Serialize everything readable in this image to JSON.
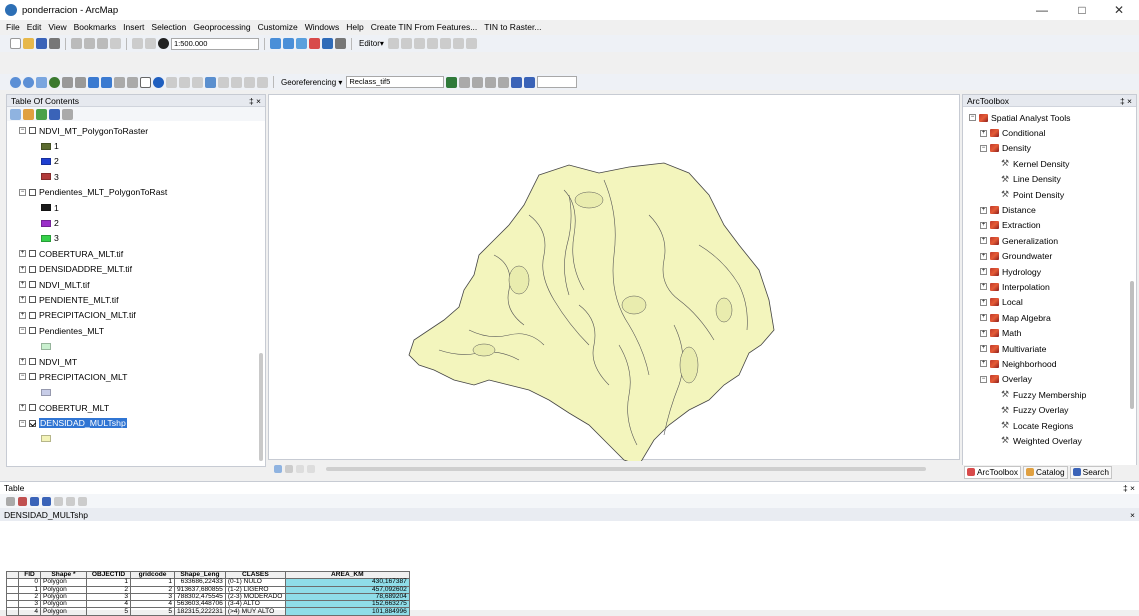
{
  "window": {
    "title": "ponderracion - ArcMap",
    "controls": [
      "—",
      "□",
      "✕"
    ]
  },
  "menu": [
    "File",
    "Edit",
    "View",
    "Bookmarks",
    "Insert",
    "Selection",
    "Geoprocessing",
    "Customize",
    "Windows",
    "Help",
    "Create TIN From Features...",
    "TIN to Raster..."
  ],
  "toolbar": {
    "scale": "1:500.000",
    "editor": "Editor▾",
    "georeferencing": "Georeferencing ▾",
    "reclass_layer": "Reclass_tif5"
  },
  "toc": {
    "title": "Table Of Contents",
    "pin": "‡ ×",
    "rows": [
      {
        "type": "layer",
        "expand": "−",
        "checked": false,
        "label": "NDVI_MT_PolygonToRaster"
      },
      {
        "type": "legend",
        "color": "#5b6b2f",
        "label": "1"
      },
      {
        "type": "legend",
        "color": "#1f3fd1",
        "label": "2"
      },
      {
        "type": "legend",
        "color": "#b23b3b",
        "label": "3"
      },
      {
        "type": "layer",
        "expand": "−",
        "checked": false,
        "label": "Pendientes_MLT_PolygonToRast"
      },
      {
        "type": "legend",
        "color": "#1a1a1a",
        "label": "1"
      },
      {
        "type": "legend",
        "color": "#9b2fc9",
        "label": "2"
      },
      {
        "type": "legend",
        "color": "#35d04a",
        "label": "3"
      },
      {
        "type": "layer",
        "expand": "+",
        "checked": false,
        "label": "COBERTURA_MLT.tif"
      },
      {
        "type": "layer",
        "expand": "+",
        "checked": false,
        "label": "DENSIDADDRE_MLT.tif"
      },
      {
        "type": "layer",
        "expand": "+",
        "checked": false,
        "label": "NDVI_MLT.tif"
      },
      {
        "type": "layer",
        "expand": "+",
        "checked": false,
        "label": "PENDIENTE_MLT.tif"
      },
      {
        "type": "layer",
        "expand": "+",
        "checked": false,
        "label": "PRECIPITACION_MLT.tif"
      },
      {
        "type": "layer",
        "expand": "−",
        "checked": false,
        "label": "Pendientes_MLT"
      },
      {
        "type": "legend",
        "color": "#c9f0cf",
        "label": ""
      },
      {
        "type": "layer",
        "expand": "+",
        "checked": false,
        "label": "NDVI_MT"
      },
      {
        "type": "layer",
        "expand": "−",
        "checked": false,
        "label": "PRECIPITACION_MLT"
      },
      {
        "type": "legend",
        "color": "#c8cde8",
        "label": ""
      },
      {
        "type": "layer",
        "expand": "+",
        "checked": false,
        "label": "COBERTUR_MLT"
      },
      {
        "type": "layer",
        "expand": "−",
        "checked": true,
        "selected": true,
        "label": "DENSIDAD_MULTshp"
      },
      {
        "type": "legend",
        "color": "#f3f3b8",
        "label": ""
      }
    ]
  },
  "toolbox": {
    "title": "ArcToolbox",
    "pin": "‡ ×",
    "rows": [
      {
        "level": 0,
        "expand": "−",
        "icon": "toolbox",
        "label": "Spatial Analyst Tools"
      },
      {
        "level": 1,
        "expand": "+",
        "icon": "toolset",
        "label": "Conditional"
      },
      {
        "level": 1,
        "expand": "−",
        "icon": "toolset",
        "label": "Density"
      },
      {
        "level": 2,
        "expand": "",
        "icon": "tool",
        "label": "Kernel Density"
      },
      {
        "level": 2,
        "expand": "",
        "icon": "tool",
        "label": "Line Density"
      },
      {
        "level": 2,
        "expand": "",
        "icon": "tool",
        "label": "Point Density"
      },
      {
        "level": 1,
        "expand": "+",
        "icon": "toolset",
        "label": "Distance"
      },
      {
        "level": 1,
        "expand": "+",
        "icon": "toolset",
        "label": "Extraction"
      },
      {
        "level": 1,
        "expand": "+",
        "icon": "toolset",
        "label": "Generalization"
      },
      {
        "level": 1,
        "expand": "+",
        "icon": "toolset",
        "label": "Groundwater"
      },
      {
        "level": 1,
        "expand": "+",
        "icon": "toolset",
        "label": "Hydrology"
      },
      {
        "level": 1,
        "expand": "+",
        "icon": "toolset",
        "label": "Interpolation"
      },
      {
        "level": 1,
        "expand": "+",
        "icon": "toolset",
        "label": "Local"
      },
      {
        "level": 1,
        "expand": "+",
        "icon": "toolset",
        "label": "Map Algebra"
      },
      {
        "level": 1,
        "expand": "+",
        "icon": "toolset",
        "label": "Math"
      },
      {
        "level": 1,
        "expand": "+",
        "icon": "toolset",
        "label": "Multivariate"
      },
      {
        "level": 1,
        "expand": "+",
        "icon": "toolset",
        "label": "Neighborhood"
      },
      {
        "level": 1,
        "expand": "−",
        "icon": "toolset",
        "label": "Overlay"
      },
      {
        "level": 2,
        "expand": "",
        "icon": "tool",
        "label": "Fuzzy Membership"
      },
      {
        "level": 2,
        "expand": "",
        "icon": "tool",
        "label": "Fuzzy Overlay"
      },
      {
        "level": 2,
        "expand": "",
        "icon": "tool",
        "label": "Locate Regions"
      },
      {
        "level": 2,
        "expand": "",
        "icon": "tool",
        "label": "Weighted Overlay"
      }
    ],
    "tabs": [
      "ArcToolbox",
      "Catalog",
      "Search"
    ]
  },
  "table": {
    "pane_title": "Table",
    "pin": "‡ ×",
    "layer_tab": "DENSIDAD_MULTshp",
    "close": "×",
    "columns": [
      "",
      "FID",
      "Shape *",
      "OBJECTID",
      "gridcode",
      "Shape_Leng",
      "CLASES",
      "AREA_KM"
    ],
    "rows": [
      [
        "0",
        "Polygon",
        "1",
        "1",
        "633686,22433",
        "(0-1) NULO",
        "430,167387"
      ],
      [
        "1",
        "Polygon",
        "2",
        "2",
        "913637,680855",
        "(1-2) LIGERO",
        "457,092602"
      ],
      [
        "2",
        "Polygon",
        "3",
        "3",
        "788302,475545",
        "(2-3) MODERADO",
        "78,689204"
      ],
      [
        "3",
        "Polygon",
        "4",
        "4",
        "563603,448706",
        "(3-4) ALTO",
        "152,663275"
      ],
      [
        "4",
        "Polygon",
        "5",
        "5",
        "182315,222231",
        "(>4) MUY ALTO",
        "101,884996"
      ]
    ]
  },
  "map_status_icons": [
    "data-view-icon",
    "layout-view-icon",
    "refresh-icon",
    "pause-icon"
  ]
}
